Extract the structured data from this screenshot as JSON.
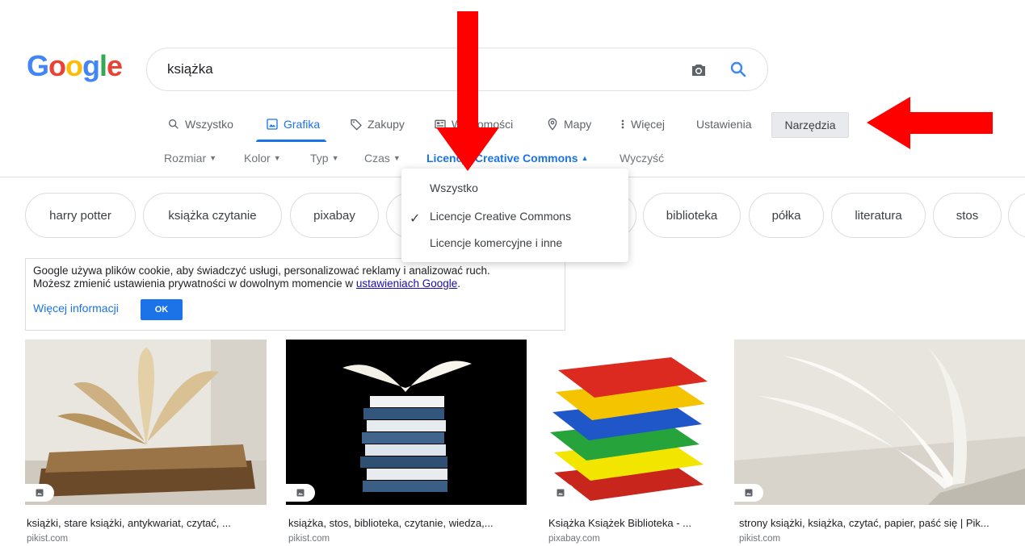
{
  "logo": {
    "letters": [
      "G",
      "o",
      "o",
      "g",
      "l",
      "e"
    ],
    "colors": [
      "#4285F4",
      "#EA4335",
      "#FBBC05",
      "#4285F4",
      "#34A853",
      "#EA4335"
    ]
  },
  "search": {
    "query": "książka",
    "camera_icon": "camera-icon",
    "search_icon": "search-icon"
  },
  "tabs": [
    {
      "label": "Wszystko",
      "icon": "search-icon"
    },
    {
      "label": "Grafika",
      "icon": "image-icon",
      "active": true
    },
    {
      "label": "Zakupy",
      "icon": "tag-icon"
    },
    {
      "label": "Wiadomości",
      "icon": "news-icon"
    },
    {
      "label": "Mapy",
      "icon": "map-pin-icon"
    },
    {
      "label": "Więcej",
      "icon": "more-vert-icon"
    }
  ],
  "settings_label": "Ustawienia",
  "tools_label": "Narzędzia",
  "filters": [
    {
      "label": "Rozmiar"
    },
    {
      "label": "Kolor"
    },
    {
      "label": "Typ"
    },
    {
      "label": "Czas"
    },
    {
      "label": "Licencje Creative Commons",
      "active": true
    },
    {
      "label": "Wyczyść"
    }
  ],
  "dropdown": {
    "items": [
      "Wszystko",
      "Licencje Creative Commons",
      "Licencje komercyjne i inne"
    ],
    "selected_index": 1
  },
  "chips": [
    "harry potter",
    "książka czytanie",
    "pixabay",
    "",
    "biblioteka",
    "półka",
    "literatura",
    "stos",
    ""
  ],
  "cookie": {
    "line1": "Google używa plików cookie, aby świadczyć usługi, personalizować reklamy i analizować ruch.",
    "line2_prefix": "Możesz zmienić ustawienia prywatności w dowolnym momencie w ",
    "line2_link": "ustawieniach Google",
    "line2_suffix": ".",
    "more_label": "Więcej informacji",
    "ok_label": "OK"
  },
  "results": [
    {
      "caption": "książki, stare książki, antykwariat, czytać, ...",
      "source": "pikist.com"
    },
    {
      "caption": "książka, stos, biblioteka, czytanie, wiedza,...",
      "source": "pikist.com"
    },
    {
      "caption": "Książka Książek Biblioteka - ...",
      "source": "pixabay.com"
    },
    {
      "caption": "strony książki, książka, czytać, papier, paść się | Pik...",
      "source": "pikist.com"
    }
  ],
  "colors": {
    "accent": "#1a73e8",
    "annotation_arrow": "#ff0000"
  }
}
